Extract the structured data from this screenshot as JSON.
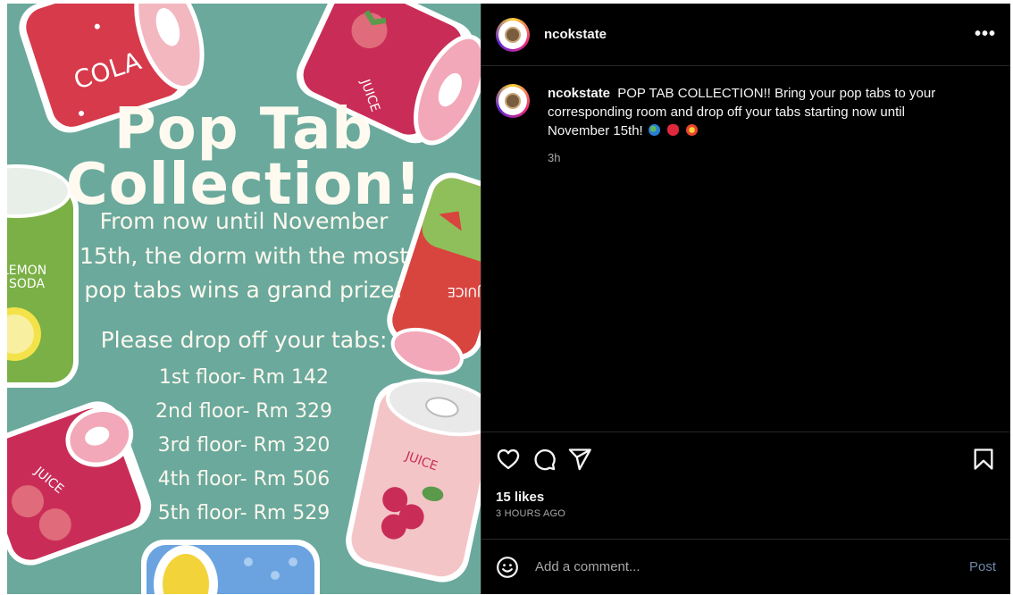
{
  "post": {
    "image": {
      "title_line1": "Pop Tab",
      "title_line2": "Collection!",
      "sub_line1": "From now until November",
      "sub_line2": "15th, the dorm with the most",
      "sub_line3": "pop tabs wins a grand prize!",
      "drop_heading": "Please drop off your tabs:",
      "floors": [
        "1st floor- Rm 142",
        "2nd floor- Rm 329",
        "3rd floor- Rm 320",
        "4th floor- Rm 506",
        "5th floor- Rm 529"
      ],
      "can_labels": {
        "cola": "COLA",
        "juice_top": "JUICE",
        "lemon": "LEMON",
        "soda": "SODA",
        "juice_right": "JUICE",
        "juice_bottom_left": "JUICE",
        "juice_bottom_right": "JUICE"
      }
    }
  },
  "panel": {
    "header": {
      "username": "ncokstate",
      "more_label": "•••"
    },
    "caption": {
      "username": "ncokstate",
      "text": "POP TAB COLLECTION!! Bring your pop tabs to your corresponding room and drop off your tabs starting now until November 15th!",
      "time": "3h"
    },
    "likes": "15 likes",
    "post_age": "3 HOURS AGO",
    "comment": {
      "placeholder": "Add a comment...",
      "post_label": "Post"
    }
  }
}
